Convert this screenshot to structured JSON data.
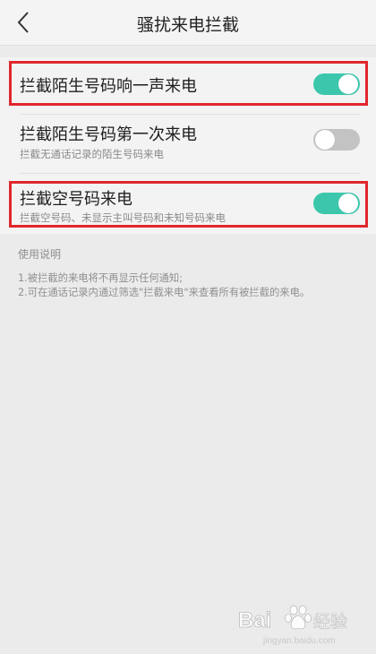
{
  "header": {
    "title": "骚扰来电拦截",
    "back_icon": "chevron-left-icon"
  },
  "settings": [
    {
      "title": "拦截陌生号码响一声来电",
      "subtitle": "",
      "enabled": true
    },
    {
      "title": "拦截陌生号码第一次来电",
      "subtitle": "拦截无通话记录的陌生号码来电",
      "enabled": false
    },
    {
      "title": "拦截空号码来电",
      "subtitle": "拦截空号码、未显示主叫号码和未知号码来电",
      "enabled": true
    }
  ],
  "instructions": {
    "label": "使用说明",
    "lines": [
      "1.被拦截的来电将不再显示任何通知;",
      "2.可在通话记录内通过筛选\"拦截来电\"来查看所有被拦截的来电。"
    ]
  },
  "watermark": {
    "brand": "Bai",
    "brand_suffix": "经验",
    "url": "jingyan.baidu.com"
  },
  "colors": {
    "toggle_on": "#3cc7ad",
    "toggle_off": "#c3c3c3",
    "highlight_border": "#e0272d"
  }
}
